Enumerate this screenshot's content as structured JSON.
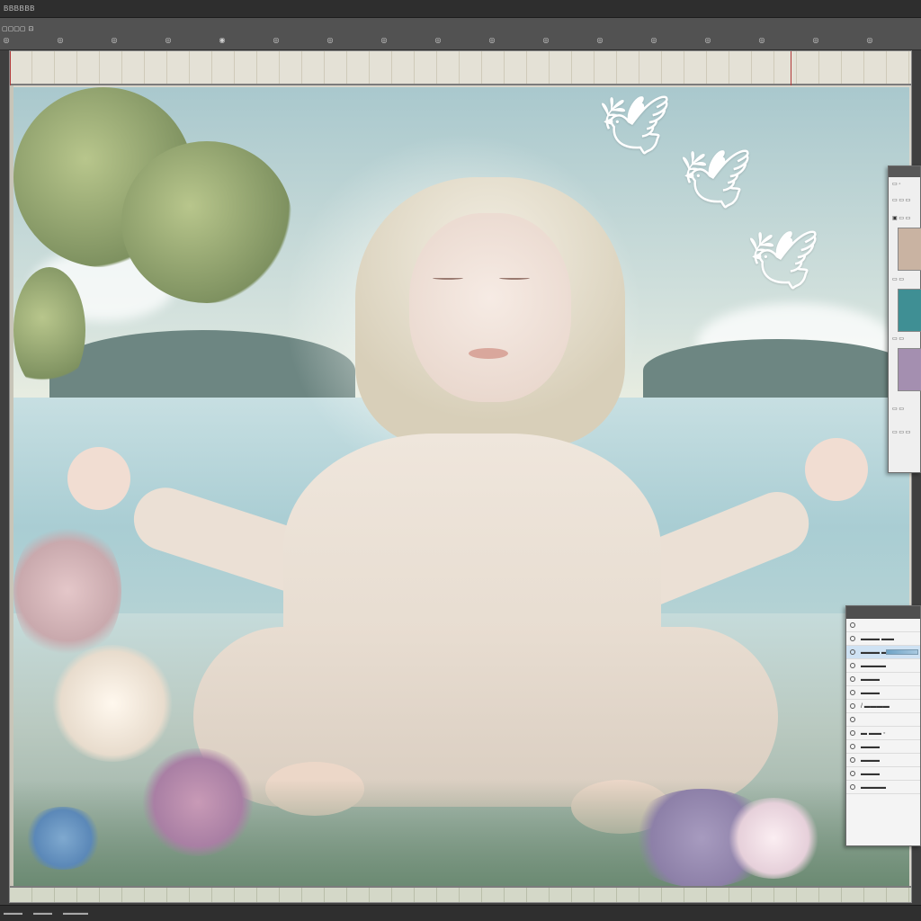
{
  "menubar": {
    "app_label": "BBBBBB"
  },
  "options": {
    "size_label": "▢▢▢▢",
    "toggle_icon": "lock-icon"
  },
  "tools": [
    "◎",
    "◎",
    "◎",
    "◎",
    "◉",
    "◎",
    "◎",
    "◎",
    "◎",
    "◎",
    "◎",
    "◎",
    "◎",
    "◎",
    "◎",
    "◎",
    "◎"
  ],
  "birds": [
    "🕊",
    "🕊",
    "🕊"
  ],
  "swatch_panel": {
    "header_glyph": "□",
    "rows": [
      "▭ ◦",
      "▭ ▭ ▭",
      "▣ ▭ ▭",
      "▭ ▭",
      "▭ ▭",
      "▭ ▭",
      "▭ ▭ ▭"
    ],
    "swatches": [
      "#c9b3a2",
      "#3f8f94",
      "#a48fb0"
    ]
  },
  "layers_panel": {
    "rows": [
      {
        "label": "",
        "active": false
      },
      {
        "label": "▬▬▬ ▬▬",
        "active": false
      },
      {
        "label": "▬▬▬ ▬▬▬▬",
        "active": true
      },
      {
        "label": "▬▬▬▬",
        "active": false
      },
      {
        "label": "▬▬▬",
        "active": false
      },
      {
        "label": "▬▬▬",
        "active": false
      },
      {
        "label": "/ ▬▬▬▬",
        "active": false
      },
      {
        "label": "",
        "active": false
      },
      {
        "label": "▬ ▬▬ ◦",
        "active": false
      },
      {
        "label": "▬▬▬",
        "active": false
      },
      {
        "label": "▬▬▬",
        "active": false
      },
      {
        "label": "▬▬▬",
        "active": false
      },
      {
        "label": "▬▬▬▬",
        "active": false
      }
    ]
  },
  "status": {
    "left": "▬▬▬",
    "mid": "▬▬▬",
    "right": "▬▬▬▬"
  }
}
